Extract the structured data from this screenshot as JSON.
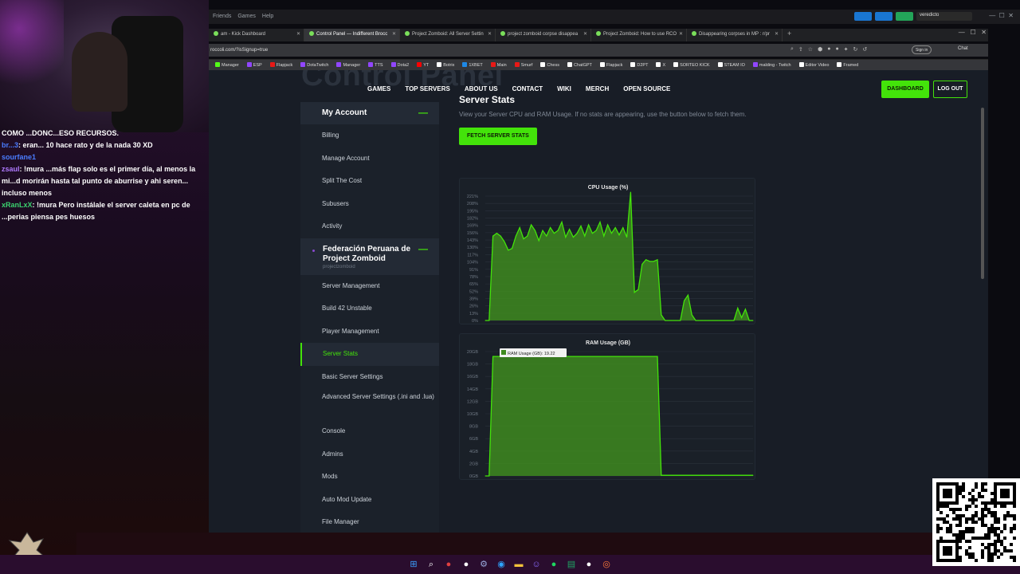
{
  "overlay": {
    "chat": [
      {
        "nick": "",
        "text": "COMO ...DONC...ESO RECURSOS.",
        "color": "#ffffff"
      },
      {
        "nick": "br...3",
        "text": ": eran... 10 hace rato y de la nada 30 XD",
        "color": "#4a7cff"
      },
      {
        "nick": "sourfane1",
        "text": "",
        "color": "#4a7cff"
      },
      {
        "nick": "zsaul",
        "text": ": !mura ...más flap solo es el primer día, al menos la mi...d morirán hasta tal punto de aburrise y ahi seren... incluso menos",
        "color": "#b07aff"
      },
      {
        "nick": "xRanLxX",
        "text": ": !mura Pero instálale el server caleta en pc de ...perias piensa pes huesos",
        "color": "#3bd16f"
      }
    ]
  },
  "os_topbar": {
    "menu": [
      "Friends",
      "Games",
      "Help"
    ],
    "user": "veredicto"
  },
  "browser": {
    "tabs": [
      {
        "title": "am - Kick Dashboard",
        "active": false
      },
      {
        "title": "Control Panel — Indifferent Brocc",
        "active": true
      },
      {
        "title": "Project Zomboid: All Server Settin",
        "active": false
      },
      {
        "title": "project zomboid corpse disappea",
        "active": false
      },
      {
        "title": "Project Zomboid: How to use RCO",
        "active": false
      },
      {
        "title": "Disappearing corpses in MP : r/pr",
        "active": false
      }
    ],
    "url": "roccoli.com/?isSignup=true",
    "signin": "Sign in",
    "chat": "Chat",
    "bookmarks": [
      {
        "label": "Manager",
        "color": "#53fc18"
      },
      {
        "label": "ESP",
        "color": "#9146ff"
      },
      {
        "label": "Flapjack",
        "color": "#e91916"
      },
      {
        "label": "DotaTwitch",
        "color": "#9146ff"
      },
      {
        "label": "Manager",
        "color": "#9146ff"
      },
      {
        "label": "TTS",
        "color": "#9146ff"
      },
      {
        "label": "Dota2",
        "color": "#9146ff"
      },
      {
        "label": "YT",
        "color": "#ff0000"
      },
      {
        "label": "Botrix",
        "color": "#ffffff"
      },
      {
        "label": "1XBET",
        "color": "#1e88e5"
      },
      {
        "label": "Main",
        "color": "#e91916"
      },
      {
        "label": "Smurf",
        "color": "#e91916"
      },
      {
        "label": "Chess",
        "color": "#ffffff"
      },
      {
        "label": "ChatGPT",
        "color": "#ffffff"
      },
      {
        "label": "Flapjack",
        "color": "#ffffff"
      },
      {
        "label": "D2PT",
        "color": "#ffffff"
      },
      {
        "label": "X",
        "color": "#ffffff"
      },
      {
        "label": "SORTEO KICK",
        "color": "#ffffff"
      },
      {
        "label": "STEAM IO",
        "color": "#ffffff"
      },
      {
        "label": "malding - Twitch",
        "color": "#9146ff"
      },
      {
        "label": "Editor Video",
        "color": "#ffffff"
      },
      {
        "label": "Framed",
        "color": "#ffffff"
      }
    ]
  },
  "site": {
    "hero_title": "Control Panel",
    "nav": [
      "GAMES",
      "TOP SERVERS",
      "ABOUT US",
      "CONTACT",
      "WIKI",
      "MERCH",
      "OPEN SOURCE"
    ],
    "dashboard": "DASHBOARD",
    "logout": "LOG OUT",
    "sidebar": {
      "account_header": "My Account",
      "account_items": [
        "Billing",
        "Manage Account",
        "Split The Cost",
        "Subusers",
        "Activity"
      ],
      "server_name": "Federación Peruana de Project Zomboid",
      "server_sub": "projectzomboid",
      "server_items": [
        "Server Management",
        "Build 42 Unstable",
        "Player Management",
        "Server Stats",
        "Basic Server Settings",
        "Advanced Server Settings (.ini and .lua)",
        "Console",
        "Admins",
        "Mods",
        "Auto Mod Update",
        "File Manager"
      ],
      "active_item": "Server Stats"
    },
    "stats": {
      "title": "Server Stats",
      "desc": "View your Server CPU and RAM Usage. If no stats are appearing, use the button below to fetch them.",
      "fetch": "FETCH SERVER STATS",
      "tooltip": "RAM Usage (GB): 19.22"
    }
  },
  "colors": {
    "accent": "#43e30a",
    "area": "#3e8a1e"
  },
  "chart_data": [
    {
      "type": "area",
      "title": "CPU Usage (%)",
      "ylim": [
        0,
        221
      ],
      "yticks": [
        "221%",
        "208%",
        "195%",
        "182%",
        "169%",
        "156%",
        "143%",
        "130%",
        "117%",
        "104%",
        "91%",
        "78%",
        "65%",
        "52%",
        "39%",
        "26%",
        "13%",
        "0%"
      ],
      "grid": true,
      "series": [
        {
          "values": [
            0,
            0,
            150,
            155,
            150,
            140,
            125,
            128,
            150,
            165,
            145,
            150,
            170,
            160,
            142,
            160,
            150,
            165,
            155,
            160,
            175,
            148,
            162,
            148,
            155,
            168,
            150,
            170,
            155,
            160,
            175,
            150,
            170,
            155,
            165,
            152,
            165,
            148,
            228,
            50,
            55,
            100,
            108,
            105,
            105,
            108,
            10,
            0,
            0,
            0,
            0,
            0,
            35,
            45,
            10,
            0,
            0,
            0,
            0,
            0,
            0,
            0,
            0,
            0,
            0,
            0,
            22,
            5,
            20,
            0,
            0
          ]
        }
      ]
    },
    {
      "type": "area",
      "title": "RAM Usage (GB)",
      "ylim": [
        0,
        20
      ],
      "yticks": [
        "20GB",
        "18GB",
        "16GB",
        "14GB",
        "12GB",
        "10GB",
        "8GB",
        "6GB",
        "4GB",
        "2GB",
        "0GB"
      ],
      "grid": true,
      "series": [
        {
          "values": [
            0,
            0,
            19.22,
            19.22,
            19.22,
            19.22,
            19.22,
            19.22,
            19.22,
            19.22,
            19.22,
            19.22,
            19.22,
            19.22,
            19.22,
            19.22,
            19.22,
            19.22,
            19.22,
            19.22,
            19.22,
            19.22,
            19.22,
            19.22,
            19.22,
            19.22,
            19.22,
            19.22,
            19.22,
            19.22,
            19.22,
            19.22,
            19.22,
            19.22,
            19.22,
            19.22,
            19.22,
            19.22,
            19.22,
            19.22,
            19.22,
            19.22,
            19.22,
            19.22,
            19.22,
            19.22,
            0.1,
            0.1,
            0.1,
            0.1,
            0.1,
            0.1,
            0.1,
            0.1,
            0.1,
            0.1,
            0.1,
            0.1,
            0.1,
            0.1,
            0.1,
            0.1,
            0.1,
            0.1,
            0.1,
            0.1,
            0.1,
            0.1,
            0.1,
            0.1,
            0.1
          ]
        }
      ]
    }
  ]
}
